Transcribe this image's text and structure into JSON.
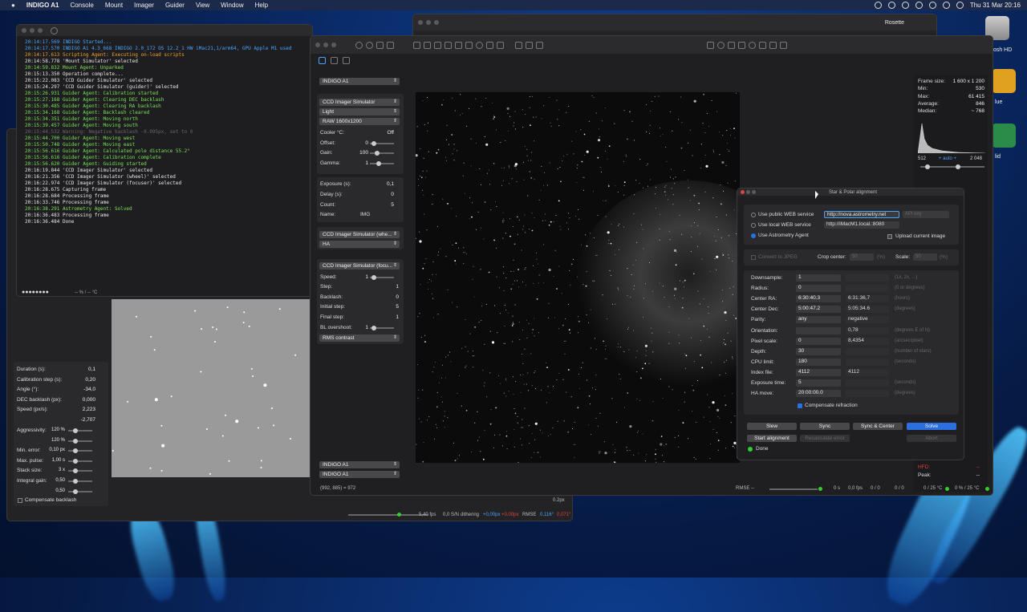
{
  "menubar": {
    "app": "INDIGO A1",
    "items": [
      "Console",
      "Mount",
      "Imager",
      "Guider",
      "View",
      "Window",
      "Help"
    ],
    "clock": "Thu 31 Mar  20:16"
  },
  "desktop": {
    "disk_label": "tosh HD",
    "folder_label": "lue",
    "app_label": "lid"
  },
  "console": {
    "log": [
      {
        "t": "20:14:17.569 INDIGO Started...",
        "c": "#4aa3ff"
      },
      {
        "t": "20:14:17.570 INDIGO A1 4.3_668 INDIGO 2.0_172 OS 12.2_1 HW iMac21,1/arm64, GPU Apple M1 used",
        "c": "#4aa3ff"
      },
      {
        "t": "20:14:17.613 Scripting Agent: Executing on-load scripts",
        "c": "#f0a030"
      },
      {
        "t": "20:14:58.778 'Mount Simulator' selected",
        "c": "#e8e8e8"
      },
      {
        "t": "20:14:59.832 Mount Agent: Unparked",
        "c": "#7de05a"
      },
      {
        "t": "20:15:13.350 Operation complete...",
        "c": "#e8e8e8"
      },
      {
        "t": "20:15:22.083 'CCD Guider Simulator' selected",
        "c": "#e8e8e8"
      },
      {
        "t": "20:15:24.297 'CCD Guider Simulator (guider)' selected",
        "c": "#e8e8e8"
      },
      {
        "t": "20:15:26.931 Guider Agent: Calibration started",
        "c": "#7de05a"
      },
      {
        "t": "20:15:27.168 Guider Agent: Clearing DEC backlash",
        "c": "#7de05a"
      },
      {
        "t": "20:15:30.485 Guider Agent: Clearing RA backlash",
        "c": "#7de05a"
      },
      {
        "t": "20:15:34.168 Guider Agent: Backlash cleared",
        "c": "#7de05a"
      },
      {
        "t": "20:15:34.351 Guider Agent: Moving north",
        "c": "#7de05a"
      },
      {
        "t": "20:15:39.457 Guider Agent: Moving south",
        "c": "#7de05a"
      },
      {
        "t": "20:15:44.532 Warning: Negative backlash -0.095px, set to 0",
        "c": "#666666"
      },
      {
        "t": "20:15:44.700 Guider Agent: Moving west",
        "c": "#7de05a"
      },
      {
        "t": "20:15:50.748 Guider Agent: Moving east",
        "c": "#7de05a"
      },
      {
        "t": "20:15:56.616 Guider Agent: Calculated pole distance 55.2°",
        "c": "#7de05a"
      },
      {
        "t": "20:15:56.616 Guider Agent: Calibration complete",
        "c": "#7de05a"
      },
      {
        "t": "20:15:56.620 Guider Agent: Guiding started",
        "c": "#7de05a"
      },
      {
        "t": "20:16:19.844 'CCD Imager Simulator' selected",
        "c": "#e8e8e8"
      },
      {
        "t": "20:16:21.356 'CCD Imager Simulator (wheel)' selected",
        "c": "#e8e8e8"
      },
      {
        "t": "20:16:22.974 'CCD Imager Simulator (focuser)' selected",
        "c": "#e8e8e8"
      },
      {
        "t": "20:16:28.675 Capturing frame",
        "c": "#e8e8e8"
      },
      {
        "t": "20:16:28.684 Processing frame",
        "c": "#e8e8e8"
      },
      {
        "t": "20:16:33.746 Processing frame",
        "c": "#e8e8e8"
      },
      {
        "t": "20:16:38.291 Astrometry Agent: Solved",
        "c": "#7de05a"
      },
      {
        "t": "20:16:36.483 Processing frame",
        "c": "#e8e8e8"
      },
      {
        "t": "20:16:36.484 Done",
        "c": "#e8e8e8"
      }
    ],
    "footer": "-- % / -- °C"
  },
  "guider": {
    "rows": [
      {
        "l": "Duration (s):",
        "v": "0,1"
      },
      {
        "l": "Calibration step (s):",
        "v": "0,20"
      },
      {
        "l": "Angle (°):",
        "v": "-34,0"
      },
      {
        "l": "DEC backlash (px):",
        "v": "0,000"
      },
      {
        "l": "Speed (px/s):",
        "v": "2,223"
      },
      {
        "l": "",
        "v": "-2,707"
      }
    ],
    "sliders": [
      {
        "l": "Aggressivity:",
        "v": "120 %"
      },
      {
        "l": "",
        "v": "120 %"
      },
      {
        "l": "Min. error:",
        "v": "0,10 px"
      },
      {
        "l": "Max. pulse:",
        "v": "1,00 s"
      },
      {
        "l": "Stack size:",
        "v": "3 x"
      },
      {
        "l": "Integral gain:",
        "v": "0,50"
      },
      {
        "l": "",
        "v": "0,50"
      }
    ],
    "compensate": "Compensate backlash",
    "status": {
      "fps": "5,40 fps",
      "snr": "0,0 S/N",
      "dithering": "dithering",
      "ra": "+0,00px",
      "dec": "+0,00px",
      "rmse": "RMSE",
      "r1": "0,116°",
      "r2": "0,071°",
      "graph": "0.2px"
    }
  },
  "rosette_title": "Rosette",
  "imager": {
    "server": "INDIGO A1",
    "camera": "CCD Imager Simulator",
    "frame_type": "Light",
    "mode": "RAW 1600x1200",
    "cooler_label": "Cooler °C:",
    "cooler_val": "Off",
    "offset_label": "Offset:",
    "offset_val": "0",
    "gain_label": "Gain:",
    "gain_val": "100",
    "gamma_label": "Gamma:",
    "gamma_val": "1",
    "exposure_label": "Exposure (s):",
    "exposure_val": "0,1",
    "delay_label": "Delay (s):",
    "delay_val": "0",
    "count_label": "Count:",
    "count_val": "5",
    "name_label": "Name:",
    "name_val": "IMG",
    "wheel": "CCD Imager Simulator (whe...",
    "filter": "HA",
    "focuser": "CCD Imager Simulator (focu...",
    "speed_label": "Speed:",
    "speed_val": "1",
    "step_label": "Step:",
    "step_val": "1",
    "backlash_label": "Backlash:",
    "backlash_val": "0",
    "istep_label": "Initial step:",
    "istep_val": "5",
    "fstep_label": "Final step:",
    "fstep_val": "1",
    "bl_label": "BL overshoot:",
    "bl_val": "1",
    "contrast": "RMS contrast",
    "bottom1": "INDIGO A1",
    "bottom2": "INDIGO A1",
    "coords": "(992, 885) = 972",
    "stats": {
      "fs_l": "Frame size:",
      "fs_v": "1 600 x 1 200",
      "min_l": "Min:",
      "min_v": "530",
      "max_l": "Max:",
      "max_v": "61 415",
      "avg_l": "Average:",
      "avg_v": "846",
      "med_l": "Median:",
      "med_v": "~ 768",
      "h_lo": "512",
      "h_auto": "+ auto +",
      "h_hi": "2 048"
    },
    "hfd_l": "HFD:",
    "hfd_v": "--",
    "peak_l": "Peak:",
    "peak_v": "--",
    "status": {
      "rmse": "RMSE --",
      "s1": "0 s",
      "s2": "0,0 fps",
      "s3": "0 / 0",
      "s4": "0 / 0",
      "s5": "0 / 25 °C",
      "s6": "0 % / 25 °C"
    }
  },
  "polar": {
    "title": "Star & Polar alignment",
    "opt1": "Use public WEB service",
    "opt1_url": "http://nova.astrometry.net",
    "opt1_key": "API key",
    "opt2": "Use local WEB service",
    "opt2_url": "http://iMacM1.local.:8080",
    "opt3": "Use Astrometry Agent",
    "upload": "Upload current image",
    "convert": "Convert to JPEG",
    "crop": "Crop center:",
    "crop_v": "50",
    "crop_u": "(%)",
    "scale": "Scale:",
    "scale_v": "50",
    "scale_u": "(%)",
    "rows": [
      {
        "l": "Downsample:",
        "a": "1",
        "b": "",
        "u": "(1x, 2x, ...)"
      },
      {
        "l": "Radius:",
        "a": "0",
        "b": "",
        "u": "(0 or degrees)"
      },
      {
        "l": "Center RA:",
        "a": "6:30:40.3",
        "b": "6:31:36,7",
        "u": "(hours)"
      },
      {
        "l": "Center Dec:",
        "a": "5:00:47.2",
        "b": "5:05:34.6",
        "u": "(degrees)"
      },
      {
        "l": "Parity:",
        "a": "any",
        "b": "negative",
        "u": ""
      },
      {
        "l": "Orientation:",
        "a": "",
        "b": "0,78",
        "u": "(degrees E of N)"
      },
      {
        "l": "Pixel scale:",
        "a": "0",
        "b": "8,4354",
        "u": "(arcsec/pixel)"
      },
      {
        "l": "Depth:",
        "a": "30",
        "b": "",
        "u": "(number of stars)"
      },
      {
        "l": "CPU limit:",
        "a": "180",
        "b": "",
        "u": "(seconds)"
      },
      {
        "l": "Index file:",
        "a": "4112",
        "b": "4112",
        "u": ""
      },
      {
        "l": "Exposure time:",
        "a": "5",
        "b": "",
        "u": "(seconds)"
      },
      {
        "l": "HA move:",
        "a": "20:00:00.0",
        "b": "",
        "u": "(degrees)"
      }
    ],
    "refraction": "Compensate refraction",
    "slew": "Slew",
    "sync": "Sync",
    "sync_center": "Sync & Center",
    "solve": "Solve",
    "start": "Start alignment",
    "recalc": "Recalculate error",
    "abort": "Abort",
    "status": "Done"
  }
}
